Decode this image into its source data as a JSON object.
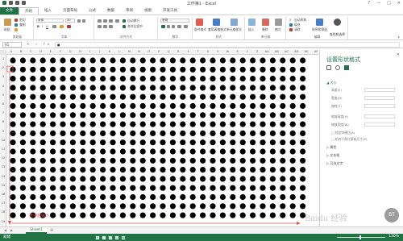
{
  "app": {
    "title": "工作簿1 - Excel",
    "window_buttons": [
      "?",
      "—",
      "□",
      "✕"
    ]
  },
  "tabs": [
    {
      "label": "文件",
      "file": true
    },
    {
      "label": "开始",
      "active": true
    },
    {
      "label": "插入"
    },
    {
      "label": "页面布局"
    },
    {
      "label": "公式"
    },
    {
      "label": "数据"
    },
    {
      "label": "审阅"
    },
    {
      "label": "视图"
    },
    {
      "label": "开发工具"
    }
  ],
  "ribbon": {
    "paste_label": "粘贴",
    "cut_label": "剪切",
    "copy_label": "复制",
    "font_name": "宋体",
    "font_size": "20",
    "wrap_label": "自动换行",
    "merge_label": "合并后居中",
    "number_format": "常规",
    "cond_format_label": "条件格式",
    "table_format_label": "套用表格格式",
    "cell_style_label": "单元格样式",
    "insert_label": "插入",
    "delete_label": "删除",
    "format_label": "格式",
    "autosum_label": "自动求和",
    "fill_label": "填充",
    "clear_label": "清除",
    "sort_label": "排序和筛选",
    "find_label": "查找和选择",
    "groups": [
      "剪贴板",
      "字体",
      "对齐方式",
      "数字",
      "样式",
      "单元格",
      "编辑"
    ]
  },
  "formula_bar": {
    "name_box": "A1",
    "fx_buttons": "✕ ✓ fx",
    "value": "●"
  },
  "columns": [
    "A",
    "B",
    "C",
    "D",
    "E",
    "F",
    "G",
    "H",
    "I",
    "J",
    "K",
    "L",
    "M",
    "N",
    "O",
    "P",
    "Q",
    "R",
    "S",
    "T",
    "U",
    "V",
    "W",
    "X",
    "Y",
    "Z",
    "AA",
    "AB",
    "AC",
    "AD",
    "AE",
    "AF"
  ],
  "rows": [
    "1",
    "2",
    "3",
    "4",
    "5",
    "6",
    "7",
    "8",
    "9",
    "10",
    "11",
    "12",
    "13",
    "14",
    "15",
    "16",
    "17",
    "18",
    "19"
  ],
  "grid": {
    "dot_symbol": "●",
    "cols": 30,
    "rows": 18,
    "dot_color": "#000000"
  },
  "pane": {
    "title": "设置形状格式",
    "close": "✕",
    "sections": [
      {
        "label": "大小",
        "expanded": true
      },
      {
        "label": "属性",
        "expanded": false
      },
      {
        "label": "文本框",
        "expanded": false
      },
      {
        "label": "可选文字",
        "expanded": false
      }
    ],
    "size_rows": [
      "高度(E)",
      "宽度(D)",
      "旋转(T)",
      "缩放高度(H)",
      "缩放宽度(W)",
      "锁定纵横比(A)",
      "相对于图片原始尺寸(R)"
    ]
  },
  "sheet_tabs": [
    "Sheet1"
  ],
  "sheet_nav": [
    "◀",
    "▶"
  ],
  "add_sheet": "⊕",
  "status": {
    "ready": "就绪",
    "zoom": "130%",
    "ime_keys": [
      "五",
      "J",
      "中",
      "☺",
      "⌨"
    ]
  },
  "overlay": {
    "red_label": "选中后输入",
    "watermark": "Baidu 经验",
    "badge": "BT"
  },
  "colors": {
    "accent": "#217346",
    "arrow": "#d9534f"
  }
}
